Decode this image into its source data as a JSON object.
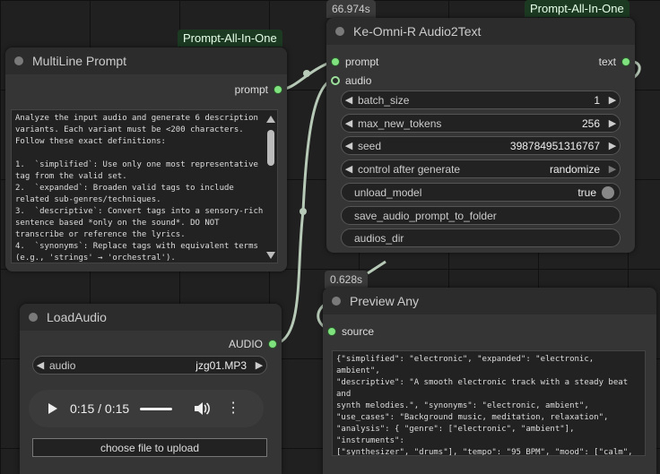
{
  "colors": {
    "canvas": "#202020",
    "node_body": "#353535",
    "node_header": "#2c2c2c",
    "badge_green": "#1c3a22",
    "port_green": "#7fe27f",
    "wire": "#b7c9b7"
  },
  "badges": {
    "time_top": "66.974s",
    "group_top": "Prompt-All-In-One",
    "group_left": "Prompt-All-In-One",
    "time_preview": "0.628s"
  },
  "multiline": {
    "title": "MultiLine Prompt",
    "output_label": "prompt",
    "text": "Analyze the input audio and generate 6 description\nvariants. Each variant must be <200 characters.\nFollow these exact definitions:\n\n1.  `simplified`: Use only one most representative\ntag from the valid set.\n2.  `expanded`: Broaden valid tags to include\nrelated sub-genres/techniques.\n3.  `descriptive`: Convert tags into a sensory-rich\nsentence based *only on the sound*. DO NOT\ntranscribe or reference the lyrics.\n4.  `synonyms`: Replace tags with equivalent terms\n(e.g., 'strings' → 'orchestral')."
  },
  "ke_omni": {
    "title": "Ke-Omni-R Audio2Text",
    "inputs": [
      "prompt",
      "audio"
    ],
    "output_label": "text",
    "widgets": [
      {
        "label": "batch_size",
        "value": "1"
      },
      {
        "label": "max_new_tokens",
        "value": "256"
      },
      {
        "label": "seed",
        "value": "398784951316767"
      },
      {
        "label": "control after generate",
        "value": "randomize"
      }
    ],
    "toggle": {
      "label": "unload_model",
      "value": "true"
    },
    "buttons": [
      "save_audio_prompt_to_folder",
      "audios_dir"
    ]
  },
  "load_audio": {
    "title": "LoadAudio",
    "output_label": "AUDIO",
    "file_label": "audio",
    "file_value": "jzg01.MP3",
    "time": "0:15 / 0:15",
    "upload_label": "choose file to upload"
  },
  "preview": {
    "title": "Preview Any",
    "input_label": "source",
    "text": "{\"simplified\": \"electronic\", \"expanded\": \"electronic, ambient\",\n\"descriptive\": \"A smooth electronic track with a steady beat and\nsynth melodies.\", \"synonyms\": \"electronic, ambient\",\n\"use_cases\": \"Background music, meditation, relaxation\",\n\"analysis\": { \"genre\": [\"electronic\", \"ambient\"], \"instruments\":\n[\"synthesizer\", \"drums\"], \"tempo\": \"95 BPM\", \"mood\": [\"calm\",\n\"relaxing\"]}, \"lyrical_rap_check\": false}"
  }
}
